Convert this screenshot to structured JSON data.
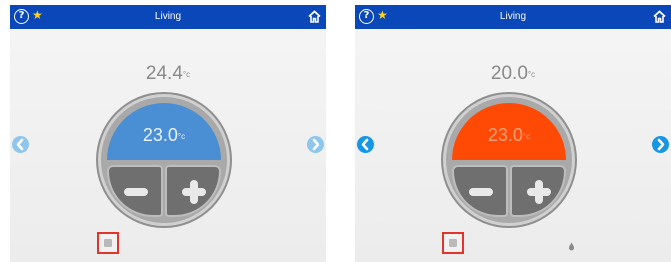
{
  "screens": [
    {
      "title": "Living",
      "current_temp": "24.4",
      "current_unit": "°c",
      "setpoint_temp": "23.0",
      "setpoint_unit": "°c",
      "mode_color": "#4a8fd4",
      "icons": [
        "help-icon",
        "star-icon",
        "home-icon",
        "chevron-left-icon",
        "chevron-right-icon",
        "minus-icon",
        "plus-icon",
        "standby-icon"
      ]
    },
    {
      "title": "Living",
      "current_temp": "20.0",
      "current_unit": "°c",
      "setpoint_temp": "23.0",
      "setpoint_unit": "°c",
      "mode_color": "#ff4a06",
      "icons": [
        "help-icon",
        "star-icon",
        "home-icon",
        "chevron-left-icon",
        "chevron-right-icon",
        "minus-icon",
        "plus-icon",
        "standby-icon",
        "water-drop-icon"
      ]
    }
  ],
  "colors": {
    "topbar": "#0a47b8",
    "highlight_box": "#e2342a"
  },
  "header": {
    "help_glyph": "?",
    "star_glyph": "★"
  }
}
